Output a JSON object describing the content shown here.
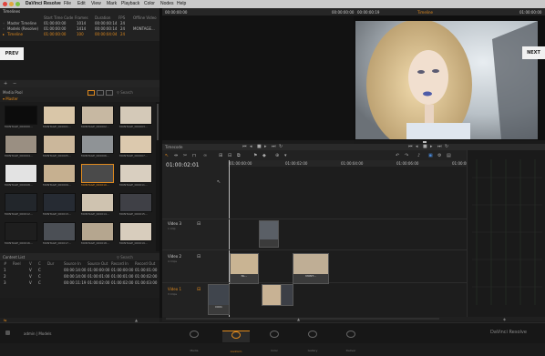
{
  "app": {
    "menu": [
      "DaVinci Resolve",
      "File",
      "Edit",
      "View",
      "Mark",
      "Playback",
      "Color",
      "Nodes",
      "Help"
    ]
  },
  "timelines": {
    "title": "Timelines",
    "columns": [
      "Start Time Code",
      "Frames",
      "Duration",
      "FPS",
      "Offline Video"
    ],
    "rows": [
      {
        "name": "Master Timeline",
        "start": "01:00:00:00",
        "frames": "1014",
        "duration": "00:00:00:14",
        "fps": "24",
        "offline": ""
      },
      {
        "name": "Models (Resolve)",
        "start": "01:00:00:00",
        "frames": "1414",
        "duration": "00:00:00:14",
        "fps": "24",
        "offline": "MONTAGE..."
      },
      {
        "name": "Timeline",
        "start": "01:00:00:00",
        "frames": "100",
        "duration": "00:00:04:04",
        "fps": "24",
        "offline": ""
      }
    ]
  },
  "viewer": {
    "left_tc": "00:00:00:00",
    "left_tc2": "00:00:00:00",
    "right_tc": "00:00:00:19",
    "right_name": "Timeline",
    "right_tc2": "01:00:00:00",
    "prev": "PREV",
    "next": "NEXT"
  },
  "media_pool": {
    "title": "Media Pool",
    "search": "Search",
    "folder": "Master",
    "clips": [
      "MONTAGE_000000...",
      "MONTAGE_000001...",
      "MONTAGE_000002...",
      "MONTAGE_000003...",
      "MONTAGE_000004...",
      "MONTAGE_000005...",
      "MONTAGE_000006...",
      "MONTAGE_000007...",
      "MONTAGE_000008...",
      "MONTAGE_000009...",
      "MONTAGE_000010...",
      "MONTAGE_000011...",
      "MONTAGE_000012...",
      "MONTAGE_000013...",
      "MONTAGE_000014...",
      "MONTAGE_000015...",
      "MONTAGE_000016...",
      "MONTAGE_000017...",
      "MONTAGE_000018...",
      "MONTAGE_000019..."
    ],
    "selected_index": 10
  },
  "edl": {
    "title": "Content List",
    "search": "Search",
    "columns": [
      "#",
      "Reel",
      "V",
      "C",
      "Dur",
      "Source In",
      "Source Out",
      "Record In",
      "Record Out"
    ],
    "rows": [
      [
        "1",
        "",
        "V",
        "C",
        "",
        "00:00:14:00",
        "01:00:00:00",
        "01:00:00:00",
        "01:00:01:00"
      ],
      [
        "2",
        "",
        "V",
        "C",
        "",
        "00:00:14:00",
        "01:00:01:00",
        "01:00:01:00",
        "01:00:02:00"
      ],
      [
        "3",
        "",
        "V",
        "C",
        "",
        "00:00:11:19",
        "01:00:02:00",
        "01:00:02:00",
        "01:00:03:00"
      ]
    ]
  },
  "timeline": {
    "tool_label": "Timecode",
    "timecode": "01:00:02:01",
    "ruler": [
      "01:00:00:00",
      "01:00:02:00",
      "01:00:04:00",
      "01:00:06:00",
      "01:00:08:00"
    ],
    "tracks": [
      {
        "name": "Video 3",
        "sub": "1 Clip"
      },
      {
        "name": "Video 2",
        "sub": "4 Clips"
      },
      {
        "name": "Video 1",
        "sub": "3 Clips"
      }
    ],
    "clip_labels": [
      "",
      "",
      "",
      "NL...",
      "MONT...",
      "",
      "",
      "C001",
      "",
      ""
    ]
  },
  "footer": {
    "project": "admin | Models",
    "pages": [
      "Media",
      "Conform",
      "Color",
      "Gallery",
      "Deliver"
    ],
    "active_page": 1,
    "brand": "DaVinci Resolve"
  }
}
